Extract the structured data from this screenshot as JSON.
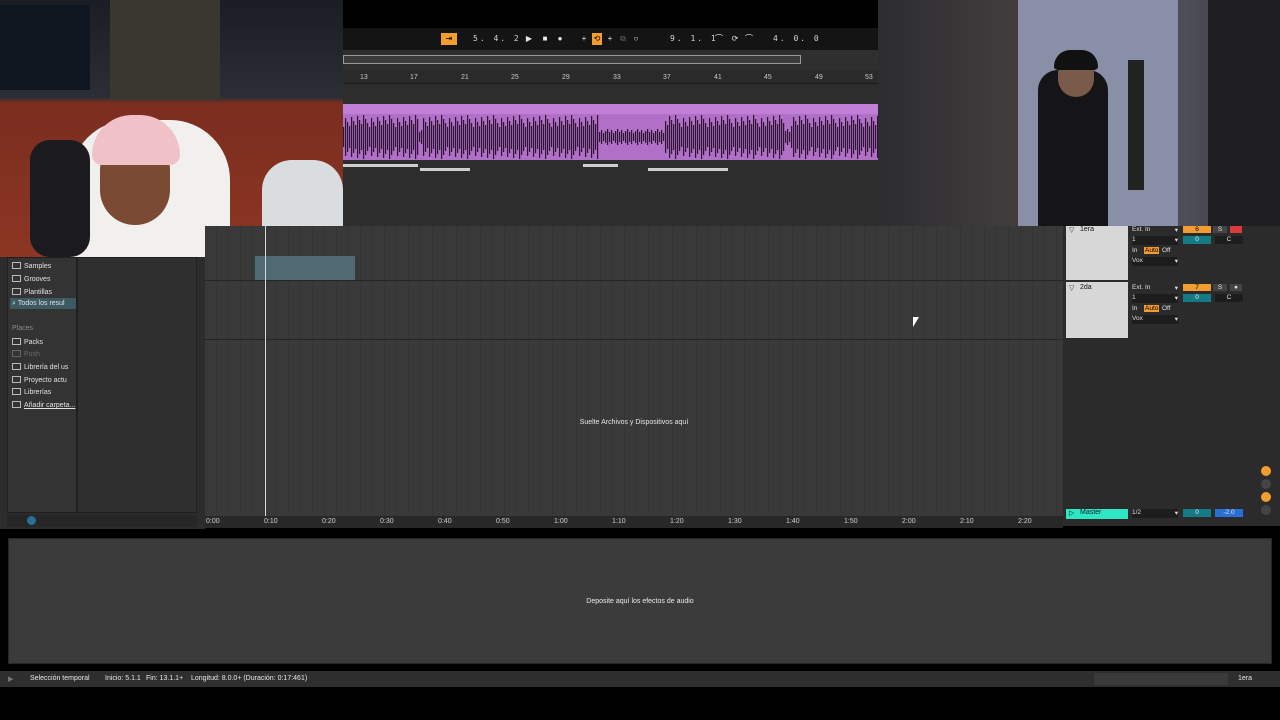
{
  "transport": {
    "position": "5.  4.  2",
    "loop_end": "9.  1.  1",
    "loop_length": "4.  0.  0"
  },
  "ruler_bars": [
    "13",
    "17",
    "21",
    "25",
    "29",
    "33",
    "37",
    "41",
    "45",
    "49",
    "53"
  ],
  "browser": {
    "categories": [
      {
        "label": "Samples",
        "icon": "folder-icon"
      },
      {
        "label": "Grooves",
        "icon": "folder-icon"
      },
      {
        "label": "Plantillas",
        "icon": "folder-icon"
      },
      {
        "label": "Todos los resul",
        "icon": "search-icon",
        "selected": true
      }
    ],
    "places_title": "Places",
    "places": [
      {
        "label": "Packs",
        "icon": "packs-icon"
      },
      {
        "label": "Push",
        "icon": "push-icon",
        "disabled": true
      },
      {
        "label": "Librería del us",
        "icon": "user-icon"
      },
      {
        "label": "Proyecto actu",
        "icon": "folder-icon"
      },
      {
        "label": "Librerías",
        "icon": "folder-icon"
      },
      {
        "label": "Añadir carpeta...",
        "icon": "add-folder-icon"
      }
    ]
  },
  "arrangement": {
    "drop_hint": "Suelte Archivos y Dispositivos aquí"
  },
  "tracks": [
    {
      "name": "1era",
      "input": "Ext. In",
      "channel": "1",
      "monitor_in": "In",
      "monitor_auto": "Auto",
      "monitor_off": "Off",
      "output": "Vox",
      "number": "6",
      "solo": "S",
      "volume": "0",
      "pan": "C"
    },
    {
      "name": "2da",
      "input": "Ext. In",
      "channel": "1",
      "monitor_in": "In",
      "monitor_auto": "Auto",
      "monitor_off": "Off",
      "output": "Vox",
      "number": "7",
      "solo": "S",
      "volume": "0",
      "pan": "C"
    }
  ],
  "master": {
    "name": "Master",
    "routing": "1/2",
    "volume": "0",
    "level": "-2.0"
  },
  "time_ruler": [
    "0:00",
    "0:10",
    "0:20",
    "0:30",
    "0:40",
    "0:50",
    "1:00",
    "1:10",
    "1:20",
    "1:30",
    "1:40",
    "1:50",
    "2:00",
    "2:10",
    "2:20"
  ],
  "device_view": {
    "drop_hint": "Deposite aquí los efectos de audio"
  },
  "status_bar": {
    "mode": "Selección temporal",
    "start": "Inicio: 5.1.1",
    "end": "Fin: 13.1.1+",
    "length": "Longitud: 8.0.0+ (Duración: 0:17:461)",
    "selected_track": "1era"
  },
  "colors": {
    "accent": "#f39c2f",
    "clip": "#b16fc7",
    "teal": "#147a86",
    "master": "#2ee6c4"
  }
}
